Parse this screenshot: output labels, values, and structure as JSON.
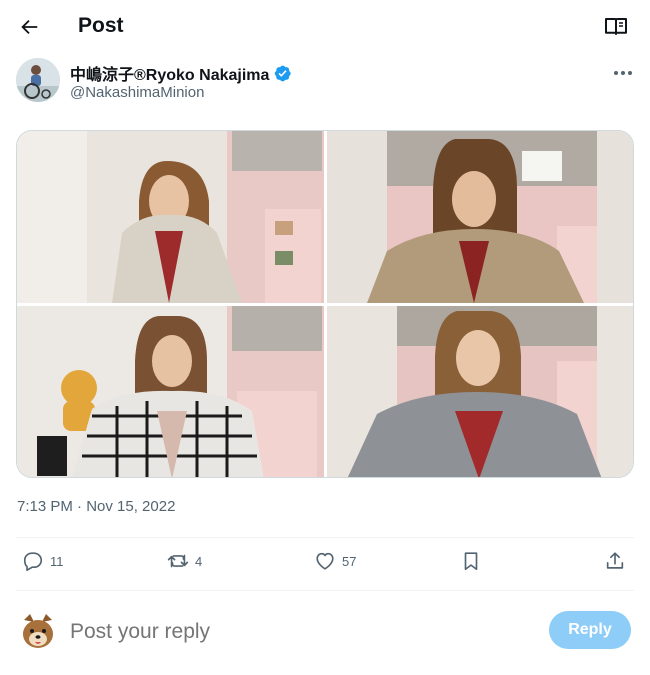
{
  "header": {
    "title": "Post",
    "back_icon": "arrow-left-icon",
    "reader_icon": "book-icon"
  },
  "author": {
    "display_name": "中嶋涼子®Ryoko Nakajima",
    "handle": "@NakashimaMinion",
    "verified": true,
    "verified_color": "#1d9bf0"
  },
  "tweet": {
    "photo_count": 4,
    "timestamp": "7:13 PM · Nov 15, 2022"
  },
  "actions": {
    "replies": "11",
    "reposts": "4",
    "likes": "57",
    "bookmark_icon": "bookmark-icon",
    "share_icon": "share-icon"
  },
  "reply": {
    "placeholder": "Post your reply",
    "button_label": "Reply",
    "button_color": "#8ecdf7"
  },
  "colors": {
    "text": "#0f1419",
    "secondary": "#536471",
    "divider": "#eff3f4"
  }
}
